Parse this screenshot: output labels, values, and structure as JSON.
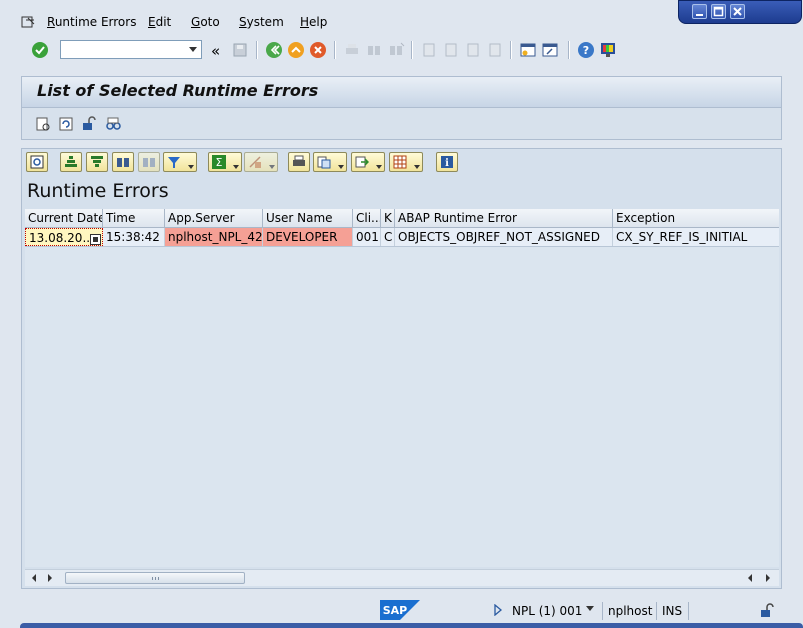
{
  "menu": {
    "items": [
      "Runtime Errors",
      "Edit",
      "Goto",
      "System",
      "Help"
    ],
    "underline": [
      "R",
      "E",
      "G",
      "S",
      "H"
    ]
  },
  "toolbar": {
    "command_value": "",
    "collapse_glyph": "«"
  },
  "page": {
    "title": "List of Selected Runtime Errors"
  },
  "grid": {
    "title": "Runtime Errors",
    "columns": [
      "Current Date",
      "Time",
      "App.Server",
      "User Name",
      "Cli...",
      "K",
      "ABAP Runtime Error",
      "Exception"
    ],
    "rows": [
      {
        "current_date": "13.08.20...",
        "time": "15:38:42",
        "app_server": "nplhost_NPL_42",
        "user_name": "DEVELOPER",
        "client": "001",
        "k": "C",
        "abap_runtime_error": "OBJECTS_OBJREF_NOT_ASSIGNED",
        "exception": "CX_SY_REF_IS_INITIAL"
      }
    ]
  },
  "status": {
    "system": "NPL (1) 001",
    "host": "nplhost",
    "mode": "INS"
  },
  "logo_text": "SAP",
  "colors": {
    "window_controls": "#1d3c8f",
    "error_cell": "#f5a095",
    "selected_cell": "#fff7c0"
  }
}
